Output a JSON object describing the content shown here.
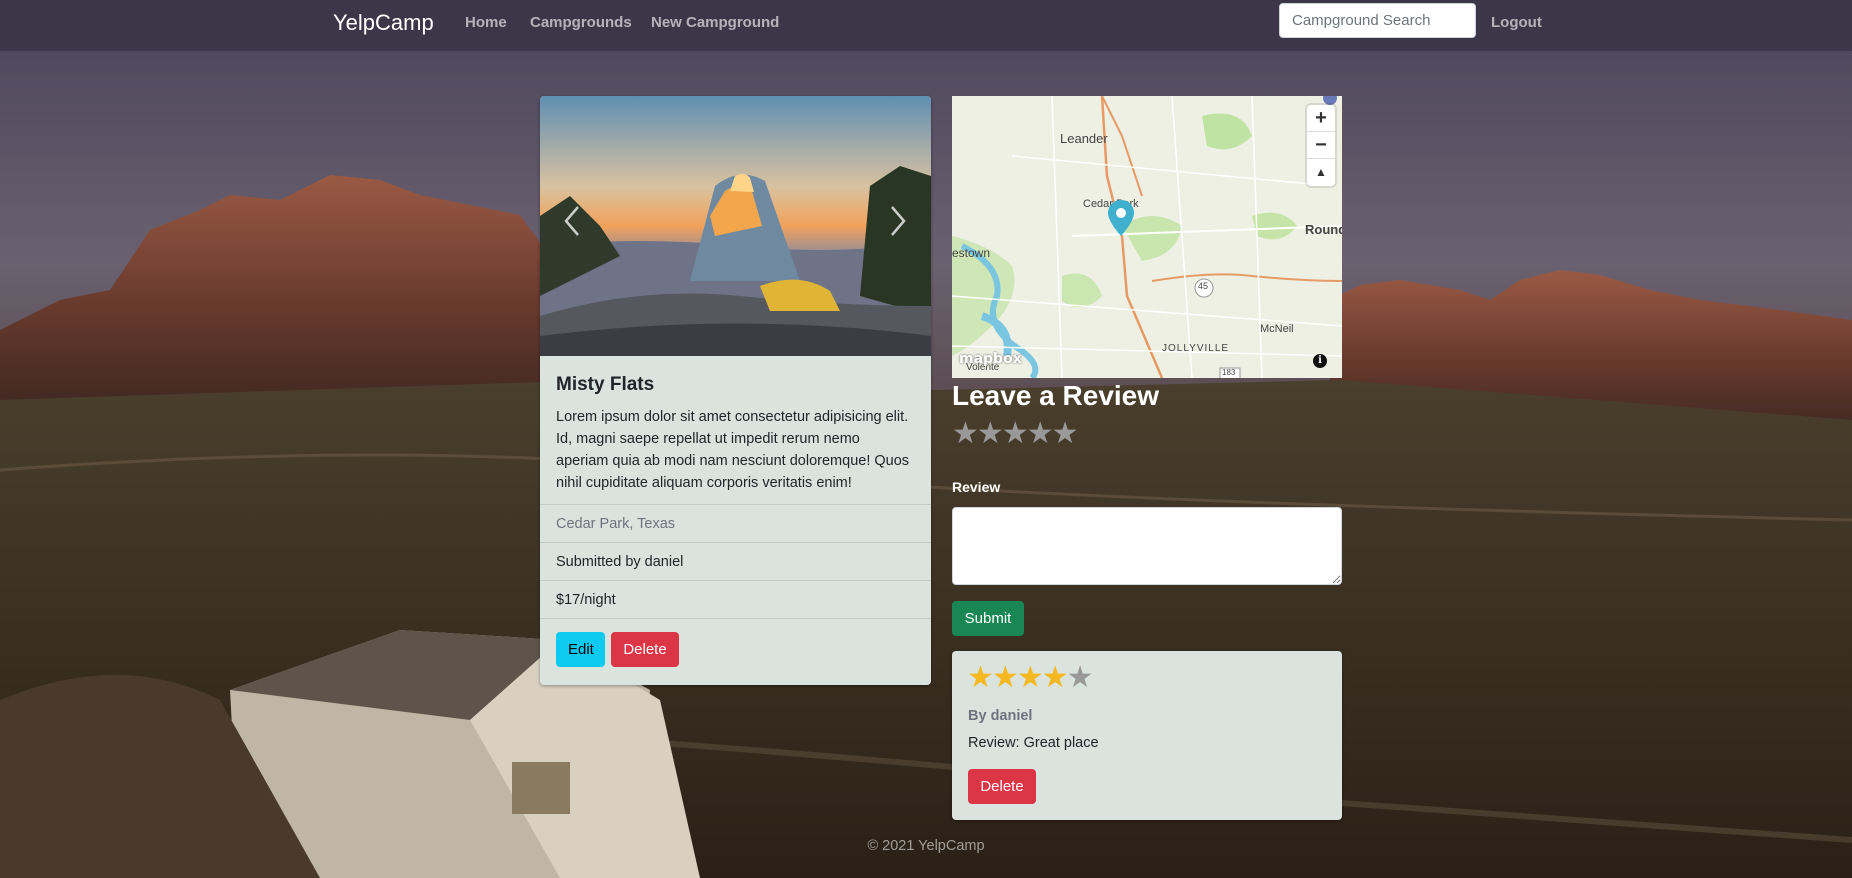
{
  "navbar": {
    "brand": "YelpCamp",
    "links": [
      "Home",
      "Campgrounds",
      "New Campground"
    ],
    "search_placeholder": "Campground Search",
    "logout": "Logout"
  },
  "campground": {
    "title": "Misty Flats",
    "description": "Lorem ipsum dolor sit amet consectetur adipisicing elit. Id, magni saepe repellat ut impedit rerum nemo aperiam quia ab modi nam nesciunt doloremque! Quos nihil cupiditate aliquam corporis veritatis enim!",
    "location": "Cedar Park, Texas",
    "submitted_by": "Submitted by daniel",
    "price": "$17/night",
    "edit_label": "Edit",
    "delete_label": "Delete",
    "carousel_prev_icon": "chevron-left-icon",
    "carousel_next_icon": "chevron-right-icon"
  },
  "map": {
    "labels": {
      "leander": "Leander",
      "cedar_park": "Cedar Park",
      "round": "Round",
      "jamestown": "estown",
      "mcneil": "McNeil",
      "jollyville": "JOLLYVILLE",
      "route_45": "45",
      "route_183": "183",
      "volente": "Volente"
    },
    "zoom_in": "+",
    "zoom_out": "−",
    "compass": "▲",
    "attribution_logo": "mapbox",
    "info": "i",
    "marker_color": "#3fb1ce"
  },
  "review_form": {
    "heading": "Leave a Review",
    "star_count": 5,
    "label": "Review",
    "submit_label": "Submit"
  },
  "reviews": [
    {
      "rating": 4,
      "max_rating": 5,
      "author": "By daniel",
      "body": "Review: Great place",
      "delete_label": "Delete"
    }
  ],
  "footer": "© 2021 YelpCamp",
  "colors": {
    "navbar_bg": "#3a3646",
    "card_bg": "#dbe3de",
    "edit_button": "#0dcaf0",
    "delete_button": "#dc3545",
    "submit_button": "#198754",
    "star_on": "#f5b820",
    "star_off": "#999999"
  }
}
